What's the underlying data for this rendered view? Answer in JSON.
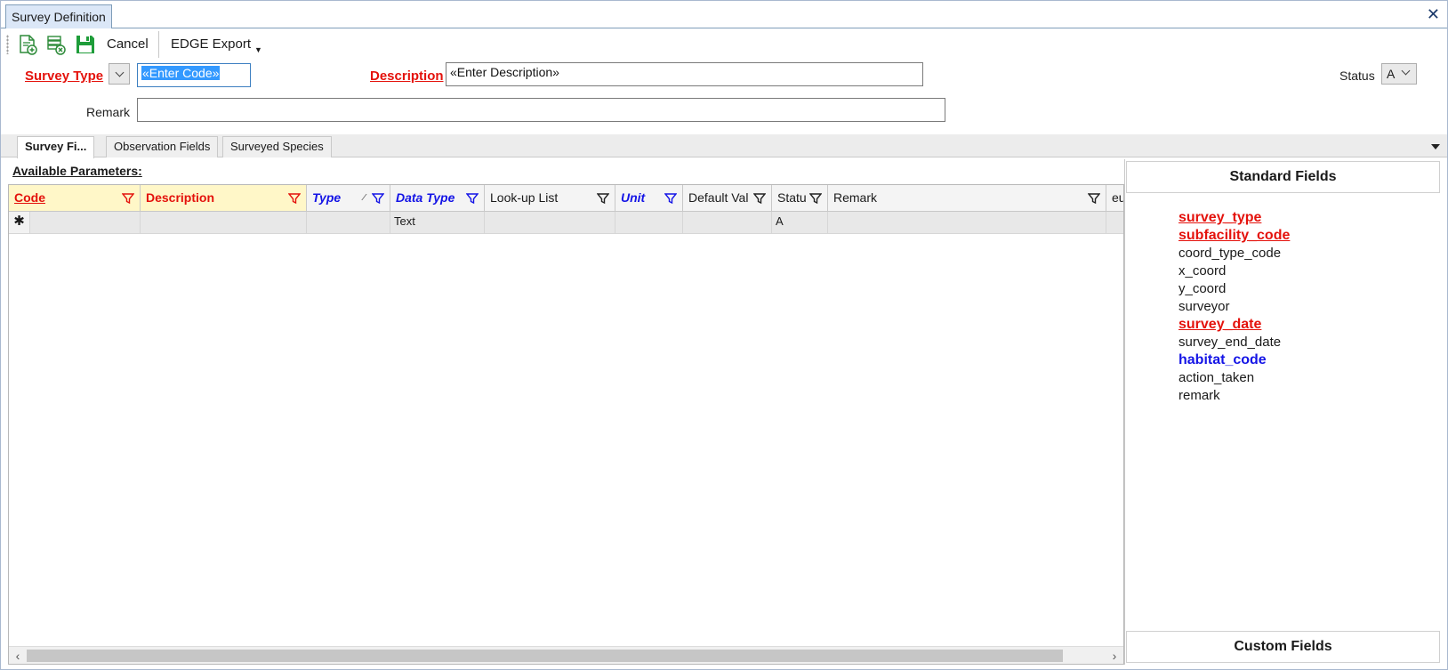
{
  "window": {
    "tab_title": "Survey Definition"
  },
  "toolbar": {
    "cancel_label": "Cancel",
    "export_label": "EDGE Export"
  },
  "form": {
    "survey_type_label": "Survey Type",
    "code_value": "«Enter Code»",
    "description_label": "Description",
    "description_value": "«Enter Description»",
    "status_label": "Status",
    "status_value": "A",
    "remark_label": "Remark",
    "remark_value": ""
  },
  "tabs": [
    {
      "label": "Survey Fi...",
      "active": true
    },
    {
      "label": "Observation Fields",
      "active": false
    },
    {
      "label": "Surveyed Species",
      "active": false
    }
  ],
  "grid": {
    "title": "Available Parameters:",
    "columns": [
      "Code",
      "Description",
      "Type",
      "Data Type",
      "Look-up List",
      "Unit",
      "Default Val",
      "Statu",
      "Remark",
      "eu"
    ],
    "new_row": {
      "indicator": "✱",
      "cells": [
        "",
        "",
        "",
        "Text",
        "",
        "",
        "",
        "A",
        "",
        ""
      ]
    }
  },
  "standard_fields": {
    "title": "Standard Fields",
    "items": [
      {
        "label": "survey_type",
        "style": "required"
      },
      {
        "label": "subfacility_code",
        "style": "required"
      },
      {
        "label": "coord_type_code",
        "style": "normal"
      },
      {
        "label": "x_coord",
        "style": "normal"
      },
      {
        "label": "y_coord",
        "style": "normal"
      },
      {
        "label": "surveyor",
        "style": "normal"
      },
      {
        "label": "survey_date",
        "style": "required"
      },
      {
        "label": "survey_end_date",
        "style": "normal"
      },
      {
        "label": "habitat_code",
        "style": "key"
      },
      {
        "label": "action_taken",
        "style": "normal"
      },
      {
        "label": "remark",
        "style": "normal"
      }
    ]
  },
  "custom_fields": {
    "title": "Custom Fields"
  },
  "colors": {
    "required": "#e4120c",
    "key": "#1414e6",
    "accent": "#3399ff"
  }
}
